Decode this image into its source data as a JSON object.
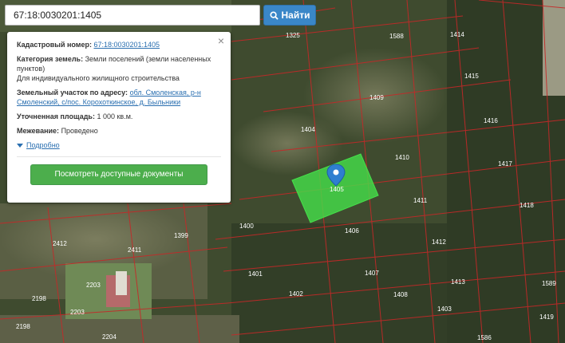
{
  "search": {
    "value": "67:18:0030201:1405",
    "button_label": "Найти"
  },
  "popup": {
    "cadastral_label": "Кадастровый номер:",
    "cadastral_value": "67:18:0030201:1405",
    "category_label": "Категория земель:",
    "category_value": "Земли поселений (земли населенных пунктов)",
    "usage_value": "Для индивидуального жилищного строительства",
    "address_label": "Земельный участок по адресу:",
    "address_value": "обл. Смоленская, р-н Смоленский, с/пос. Корохоткинское, д. Быльники",
    "area_label": "Уточненная площадь:",
    "area_value": "1 000 кв.м.",
    "survey_label": "Межевание:",
    "survey_value": "Проведено",
    "more_label": "Подробно",
    "docs_button": "Посмотреть доступные документы",
    "close_symbol": "×"
  },
  "map": {
    "selected_label": "1405",
    "parcel_labels": [
      "1325",
      "1588",
      "1414",
      "1415",
      "1409",
      "1404",
      "1416",
      "1410",
      "1417",
      "1411",
      "1418",
      "1400",
      "1406",
      "1399",
      "1412",
      "2412",
      "2411",
      "1401",
      "1407",
      "1413",
      "2203",
      "2198",
      "1402",
      "1408",
      "1589",
      "1403",
      "2203",
      "2198",
      "2204",
      "1586",
      "1419"
    ],
    "colors": {
      "parcel_line": "#c62828",
      "selection_fill": "#45e04a",
      "marker": "#2f7fd0"
    }
  }
}
